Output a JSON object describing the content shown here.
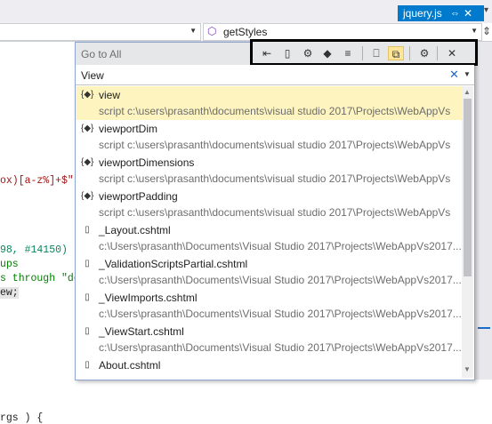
{
  "tab": {
    "title": "jquery.js",
    "pin_glyph": "⇔",
    "close_glyph": "✕"
  },
  "navbar": {
    "member_combo": "getStyles"
  },
  "code_lines": [
    {
      "text": "ox)[a-z%]+$\"",
      "color": "#a31515"
    },
    {
      "text": "98, #14150)",
      "color": "#098658"
    },
    {
      "text": "ups",
      "color": "#008000"
    },
    {
      "text": "s through \"do",
      "color": "#008000"
    },
    {
      "text": "ew;",
      "color": "#1e1e1e"
    },
    {
      "text": "rgs ) {",
      "color": "#1e1e1e"
    }
  ],
  "goto": {
    "header_label": "Go to All",
    "search_value": "View",
    "toolbar_buttons": [
      {
        "name": "line-icon",
        "glyph": "⇤",
        "active": false
      },
      {
        "name": "file-icon",
        "glyph": "▯",
        "active": false
      },
      {
        "name": "type-icon",
        "glyph": "⚙",
        "active": false
      },
      {
        "name": "member-icon",
        "glyph": "◆",
        "active": false
      },
      {
        "name": "symbol-icon",
        "glyph": "≡",
        "active": false
      },
      {
        "name": "current-document-icon",
        "glyph": "⎕",
        "active": false
      },
      {
        "name": "preview-tab-icon",
        "glyph": "⧉",
        "active": true
      },
      {
        "name": "settings-gear-icon",
        "glyph": "⚙",
        "active": false
      },
      {
        "name": "close-icon",
        "glyph": "✕",
        "active": false
      }
    ],
    "results": [
      {
        "name": "view",
        "path": "script c:\\users\\prasanth\\documents\\visual studio 2017\\Projects\\WebAppVs",
        "icon": "{◆}",
        "selected": true
      },
      {
        "name": "viewportDim",
        "path": "script c:\\users\\prasanth\\documents\\visual studio 2017\\Projects\\WebAppVs",
        "icon": "{◆}",
        "selected": false
      },
      {
        "name": "viewportDimensions",
        "path": "script c:\\users\\prasanth\\documents\\visual studio 2017\\Projects\\WebAppVs",
        "icon": "{◆}",
        "selected": false
      },
      {
        "name": "viewportPadding",
        "path": "script c:\\users\\prasanth\\documents\\visual studio 2017\\Projects\\WebAppVs",
        "icon": "{◆}",
        "selected": false
      },
      {
        "name": "_Layout.cshtml",
        "path": "c:\\Users\\prasanth\\Documents\\Visual Studio 2017\\Projects\\WebAppVs2017...",
        "icon": "▯",
        "selected": false
      },
      {
        "name": "_ValidationScriptsPartial.cshtml",
        "path": "c:\\Users\\prasanth\\Documents\\Visual Studio 2017\\Projects\\WebAppVs2017...",
        "icon": "▯",
        "selected": false
      },
      {
        "name": "_ViewImports.cshtml",
        "path": "c:\\Users\\prasanth\\Documents\\Visual Studio 2017\\Projects\\WebAppVs2017...",
        "icon": "▯",
        "selected": false
      },
      {
        "name": "_ViewStart.cshtml",
        "path": "c:\\Users\\prasanth\\Documents\\Visual Studio 2017\\Projects\\WebAppVs2017...",
        "icon": "▯",
        "selected": false
      },
      {
        "name": "About.cshtml",
        "path": "",
        "icon": "▯",
        "selected": false
      }
    ]
  }
}
